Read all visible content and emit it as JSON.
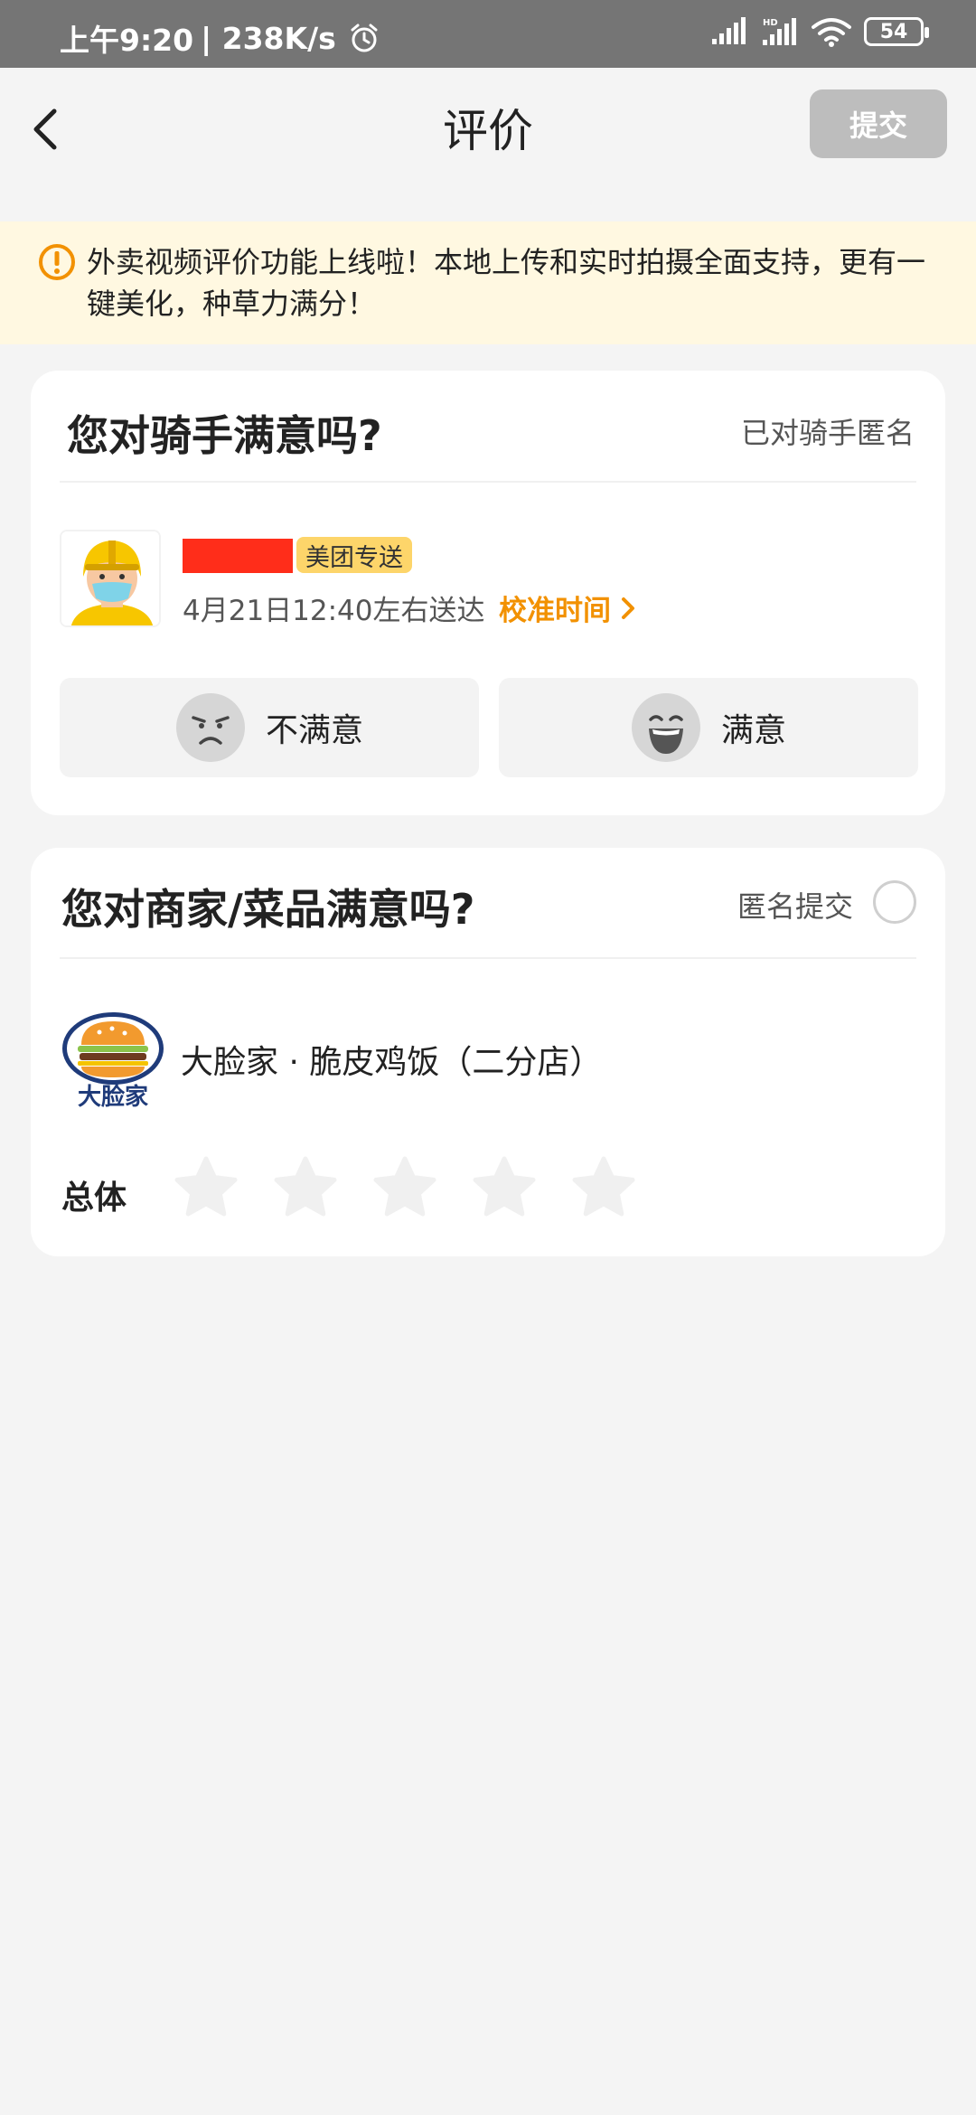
{
  "status_bar": {
    "time": "上午9:20",
    "speed": "| 238K/s",
    "battery": "54"
  },
  "header": {
    "title": "评价",
    "submit_label": "提交"
  },
  "notice": {
    "text": "外卖视频评价功能上线啦！本地上传和实时拍摄全面支持，更有一键美化，种草力满分！"
  },
  "rider_card": {
    "title": "您对骑手满意吗?",
    "anonymous_label": "已对骑手匿名",
    "delivery_badge": "美团专送",
    "delivery_time": "4月21日12:40左右送达",
    "calibrate_time": "校准时间",
    "unhappy_label": "不满意",
    "happy_label": "满意"
  },
  "merchant_card": {
    "title": "您对商家/菜品满意吗?",
    "anonymous_label": "匿名提交",
    "anonymous_checked": false,
    "logo_text": "大脸家",
    "merchant_name": "大脸家 · 脆皮鸡饭（二分店）",
    "overall_label": "总体",
    "rating": 0,
    "max_rating": 5
  },
  "colors": {
    "accent": "#f29100",
    "badge": "#fdd56a",
    "notice_bg": "#fff8e1",
    "submit_disabled": "#bdbdbd"
  }
}
